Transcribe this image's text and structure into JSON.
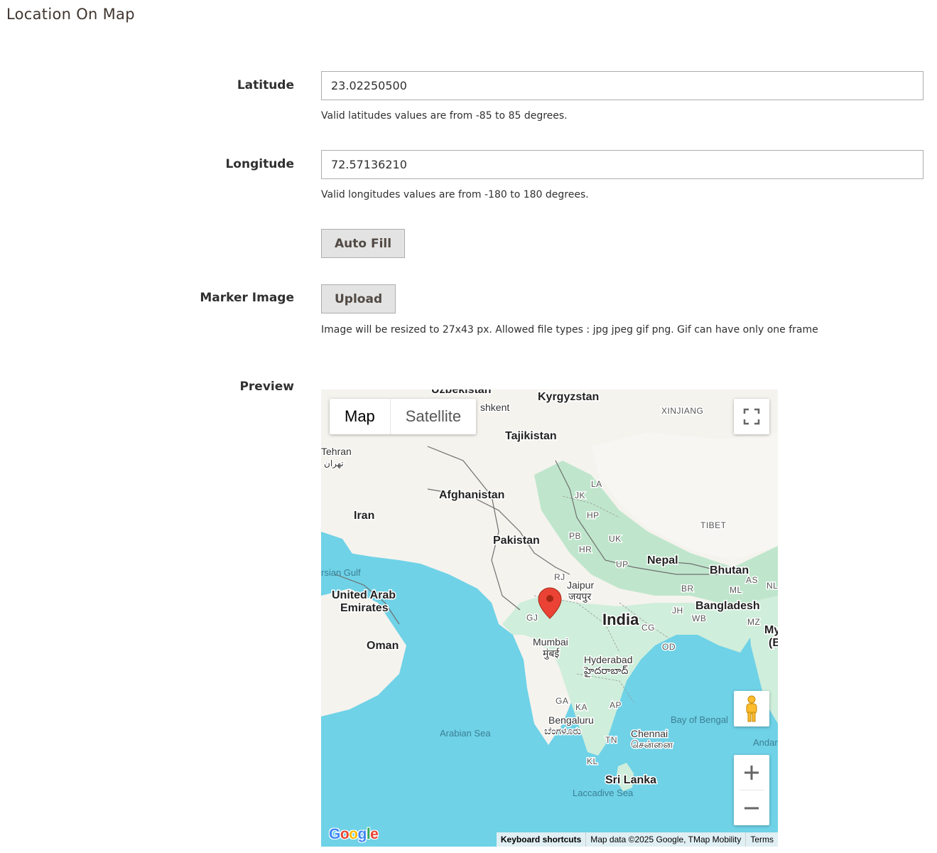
{
  "section": {
    "title": "Location On Map"
  },
  "latitude": {
    "label": "Latitude",
    "value": "23.02250500",
    "note": "Valid latitudes values are from -85 to 85 degrees."
  },
  "longitude": {
    "label": "Longitude",
    "value": "72.57136210",
    "note": "Valid longitudes values are from -180 to 180 degrees."
  },
  "autofill": {
    "label": "Auto Fill"
  },
  "marker_image": {
    "label": "Marker Image",
    "button": "Upload",
    "note": "Image will be resized to 27x43 px. Allowed file types : jpg jpeg gif png. Gif can have only one frame"
  },
  "preview": {
    "label": "Preview",
    "map_type": {
      "map": "Map",
      "satellite": "Satellite",
      "selected": "Map"
    },
    "labels": {
      "uzbekistan": "Uzbekistan",
      "kyrgyzstan": "Kyrgyzstan",
      "tashkent": "shkent",
      "tajikistan": "Tajikistan",
      "xinjiang": "XINJIANG",
      "tehran": "Tehran",
      "tehran_local": "تهران",
      "afghanistan": "Afghanistan",
      "iran": "Iran",
      "la": "LA",
      "jk": "JK",
      "hp": "HP",
      "pb": "PB",
      "uk": "UK",
      "hr": "HR",
      "tibet": "TIBET",
      "pakistan": "Pakistan",
      "persian_gulf": "rsian Gulf",
      "up": "UP",
      "nepal": "Nepal",
      "bhutan": "Bhutan",
      "rj": "RJ",
      "jaipur": "Jaipur",
      "jaipur_local": "जयपुर",
      "uae": "United Arab",
      "uae2": "Emirates",
      "br": "BR",
      "ml": "ML",
      "as": "AS",
      "nl": "NL",
      "bangladesh": "Bangladesh",
      "gj": "GJ",
      "jh": "JH",
      "wb": "WB",
      "india": "India",
      "cg": "CG",
      "mz": "MZ",
      "myanmar": "My",
      "myanmar2": "(B",
      "mumbai": "Mumbai",
      "mumbai_local": "मुंबई",
      "oman": "Oman",
      "od": "OD",
      "hyderabad": "Hyderabad",
      "hyderabad_local": "హైదరాబాద్",
      "ga": "GA",
      "ka": "KA",
      "ap": "AP",
      "bay_of_bengal": "Bay of Bengal",
      "bengaluru": "Bengaluru",
      "bengaluru_local": "ಬೆಂಗಳೂರು",
      "arabian_sea": "Arabian Sea",
      "chennai": "Chennai",
      "chennai_local": "சென்னை",
      "tn": "TN",
      "andaman": "Andar",
      "kl": "KL",
      "sri_lanka": "Sri Lanka",
      "laccadive_sea": "Laccadive Sea"
    },
    "google_logo": "Google",
    "attribution": {
      "shortcuts": "Keyboard shortcuts",
      "data": "Map data ©2025 Google, TMap Mobility",
      "terms": "Terms"
    },
    "icons": {
      "fullscreen": "fullscreen-icon",
      "pegman": "pegman-icon",
      "zoom_in": "plus-icon",
      "zoom_out": "minus-icon",
      "marker": "map-pin-icon"
    },
    "colors": {
      "water": "#6fd2e7",
      "land": "#f5f3ee",
      "green": "#bfe6cc",
      "marker": "#ea4335"
    }
  }
}
